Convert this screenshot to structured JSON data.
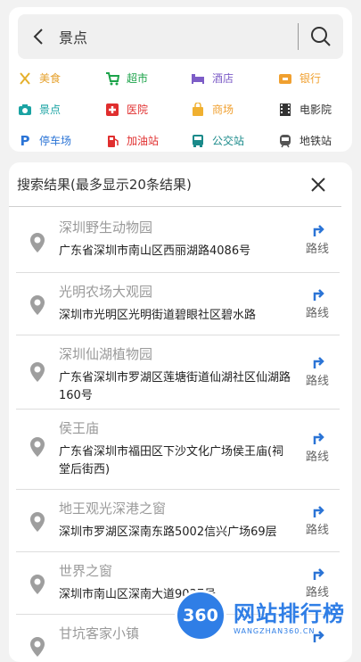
{
  "search": {
    "query": "景点"
  },
  "categories": [
    {
      "label": "美食",
      "icon": "fork-knife-icon",
      "color": "#e5b02b"
    },
    {
      "label": "超市",
      "icon": "cart-icon",
      "color": "#1ca34a"
    },
    {
      "label": "酒店",
      "icon": "bed-icon",
      "color": "#7d5dc7"
    },
    {
      "label": "银行",
      "icon": "bank-icon",
      "color": "#f0a030"
    },
    {
      "label": "景点",
      "icon": "camera-icon",
      "color": "#1aa3a3"
    },
    {
      "label": "医院",
      "icon": "hospital-cross-icon",
      "color": "#e02e2e"
    },
    {
      "label": "商场",
      "icon": "shopping-bag-icon",
      "color": "#f0b030"
    },
    {
      "label": "电影院",
      "icon": "film-icon",
      "color": "#333333"
    },
    {
      "label": "停车场",
      "icon": "parking-icon",
      "color": "#2b74d6"
    },
    {
      "label": "加油站",
      "icon": "gas-pump-icon",
      "color": "#e02e2e"
    },
    {
      "label": "公交站",
      "icon": "bus-icon",
      "color": "#1a8a8a"
    },
    {
      "label": "地铁站",
      "icon": "metro-icon",
      "color": "#555555"
    }
  ],
  "results": {
    "title": "搜索结果(最多显示20条结果)",
    "route_label": "路线",
    "items": [
      {
        "name": "深圳野生动物园",
        "address": "广东省深圳市南山区西丽湖路4086号"
      },
      {
        "name": "光明农场大观园",
        "address": "深圳市光明区光明街道碧眼社区碧水路"
      },
      {
        "name": "深圳仙湖植物园",
        "address": "广东省深圳市罗湖区莲塘街道仙湖社区仙湖路160号"
      },
      {
        "name": "侯王庙",
        "address": "广东省深圳市福田区下沙文化广场侯王庙(祠堂后街西)"
      },
      {
        "name": "地王观光深港之窗",
        "address": "深圳市罗湖区深南东路5002信兴广场69层"
      },
      {
        "name": "世界之窗",
        "address": "深圳市南山区深南大道9037号"
      },
      {
        "name": "甘坑客家小镇",
        "address": ""
      }
    ]
  },
  "watermark": {
    "badge": "360",
    "title": "网站排行榜",
    "subtitle": "WANGZHAN360.CN"
  }
}
